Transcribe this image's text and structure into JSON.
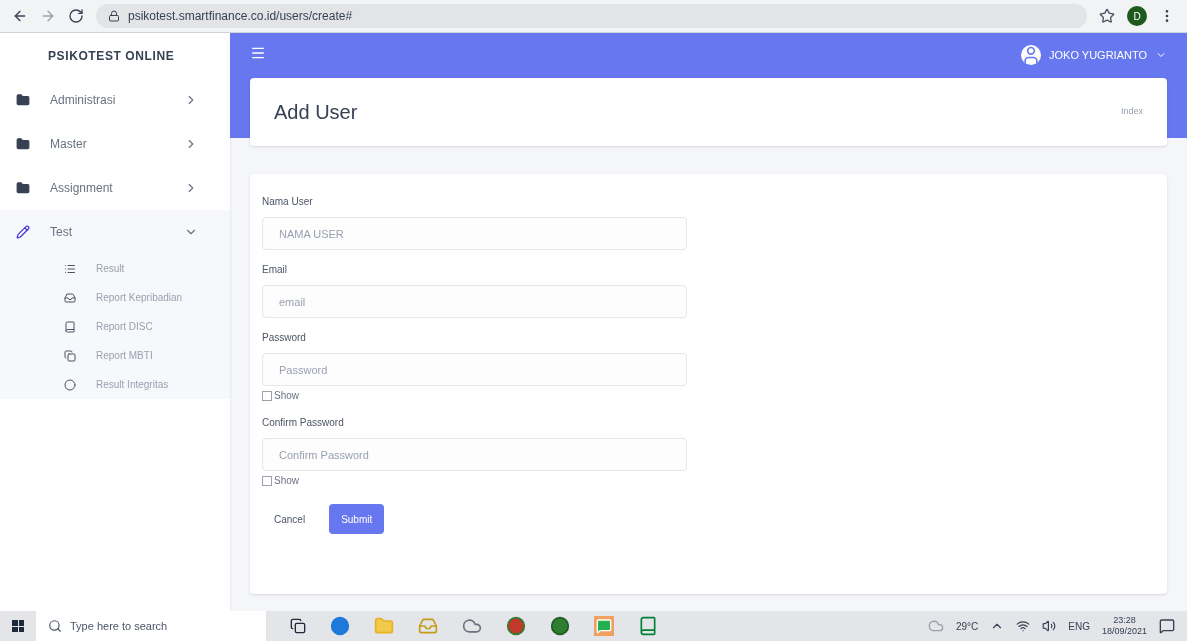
{
  "browser": {
    "url": "psikotest.smartfinance.co.id/users/create#",
    "profile_initial": "D"
  },
  "sidebar": {
    "brand": "PSIKOTEST ONLINE",
    "items": [
      {
        "label": "Administrasi",
        "expanded": false
      },
      {
        "label": "Master",
        "expanded": false
      },
      {
        "label": "Assignment",
        "expanded": false
      },
      {
        "label": "Test",
        "expanded": true,
        "children": [
          {
            "label": "Result"
          },
          {
            "label": "Report Kepribadian"
          },
          {
            "label": "Report DISC"
          },
          {
            "label": "Report MBTI"
          },
          {
            "label": "Result Integritas"
          }
        ]
      }
    ]
  },
  "header": {
    "user": "JOKO YUGRIANTO"
  },
  "page": {
    "title": "Add User",
    "breadcrumb": "Index"
  },
  "form": {
    "fields": [
      {
        "label": "Nama User",
        "placeholder": "NAMA USER",
        "kind": "text"
      },
      {
        "label": "Email",
        "placeholder": "email",
        "kind": "text"
      },
      {
        "label": "Password",
        "placeholder": "Password",
        "kind": "password",
        "show_label": "Show",
        "checked": false
      },
      {
        "label": "Confirm Password",
        "placeholder": "Confirm Password",
        "kind": "password",
        "show_label": "Show",
        "checked": false
      }
    ],
    "cancel": "Cancel",
    "submit": "Submit"
  },
  "taskbar": {
    "search_placeholder": "Type here to search",
    "temperature": "29°C",
    "language": "ENG",
    "time": "23:28",
    "date": "18/09/2021"
  }
}
